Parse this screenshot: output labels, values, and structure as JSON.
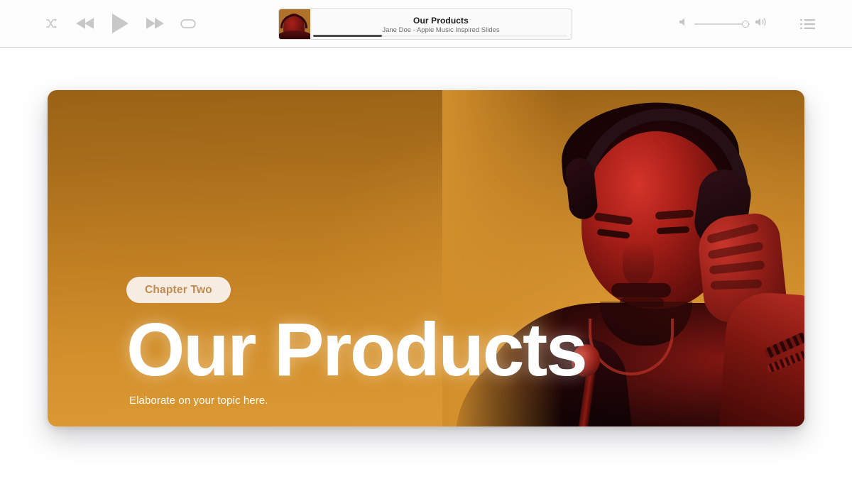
{
  "player": {
    "transport": [
      {
        "name": "shuffle-button",
        "label": "Shuffle"
      },
      {
        "name": "previous-button",
        "label": "Previous"
      },
      {
        "name": "play-button",
        "label": "Play"
      },
      {
        "name": "next-button",
        "label": "Next"
      },
      {
        "name": "repeat-button",
        "label": "Repeat"
      }
    ],
    "now_playing": {
      "title": "Our Products",
      "subtitle": "Jane Doe - Apple Music Inspired Slides",
      "progress_percent": 27,
      "artwork_alt": "Album artwork of man with headphones"
    },
    "volume": {
      "level_percent": 92,
      "mute_icon": "speaker-low-icon",
      "max_icon": "speaker-high-icon"
    },
    "queue_icon": "playlist-list-icon"
  },
  "slide": {
    "chapter_badge": "Chapter Two",
    "title": "Our Products",
    "subtitle": "Elaborate on your topic here.",
    "colors": {
      "bg_top": "#9a6216",
      "bg_bottom": "#dd9a34",
      "badge_bg": "#f6ece2",
      "badge_text": "#c08a52",
      "title_text": "#ffffff"
    },
    "photo_alt": "Man wearing headphones holding a microphone, red duotone"
  }
}
